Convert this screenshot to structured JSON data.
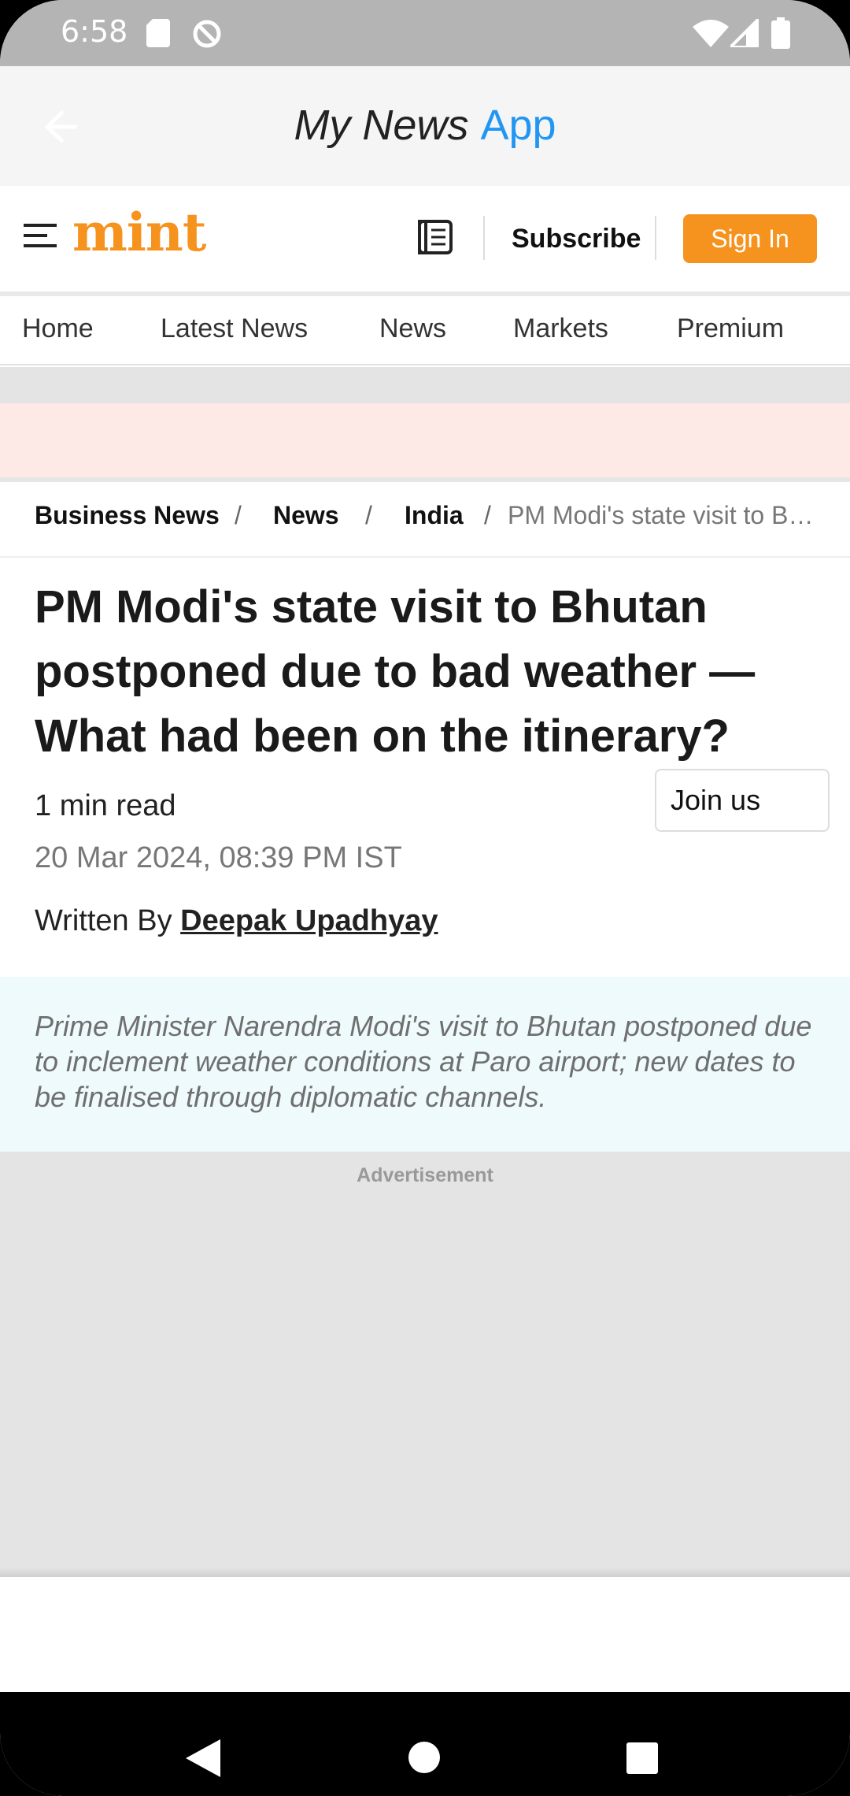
{
  "status_bar": {
    "time": "6:58",
    "icons": [
      "sd-card-icon",
      "sync-off-icon",
      "wifi-icon",
      "signal-icon",
      "battery-icon"
    ]
  },
  "app_bar": {
    "title_main": "My News",
    "title_accent": "App",
    "accent_color": "#2196f3"
  },
  "site_header": {
    "logo": "mint",
    "logo_color": "#f6921e",
    "subscribe_label": "Subscribe",
    "signin_label": "Sign In"
  },
  "nav_tabs": [
    "Home",
    "Latest News",
    "News",
    "Markets",
    "Premium"
  ],
  "breadcrumb": {
    "items": [
      "Business News",
      "News",
      "India"
    ],
    "separator": "/",
    "current": "PM Modi's state visit to B…"
  },
  "article": {
    "headline": "PM Modi's state visit to Bhutan postponed due to bad weather — What had been on the itinerary?",
    "read_time": "1 min read",
    "join_label": "Join us",
    "date": "20 Mar 2024, 08:39 PM IST",
    "byline_prefix": "Written By",
    "author": "Deepak Upadhyay",
    "summary": "Prime Minister Narendra Modi's visit to Bhutan postponed due to inclement weather conditions at Paro airport; new dates to be finalised through diplomatic channels."
  },
  "ad": {
    "label": "Advertisement"
  }
}
